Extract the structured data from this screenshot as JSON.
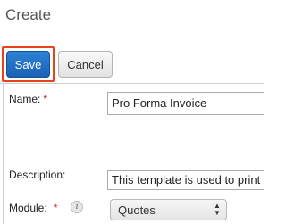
{
  "page": {
    "title": "Create"
  },
  "toolbar": {
    "save_label": "Save",
    "cancel_label": "Cancel",
    "highlight_color": "#e8421b",
    "save_color": "#1b61b6"
  },
  "form": {
    "name": {
      "label": "Name:",
      "required_marker": "*",
      "value": "Pro Forma Invoice"
    },
    "description": {
      "label": "Description:",
      "value": "This template is used to print"
    },
    "module": {
      "label": "Module:",
      "required_marker": "*",
      "info_icon": "info-icon",
      "selected_value": "Quotes"
    }
  }
}
